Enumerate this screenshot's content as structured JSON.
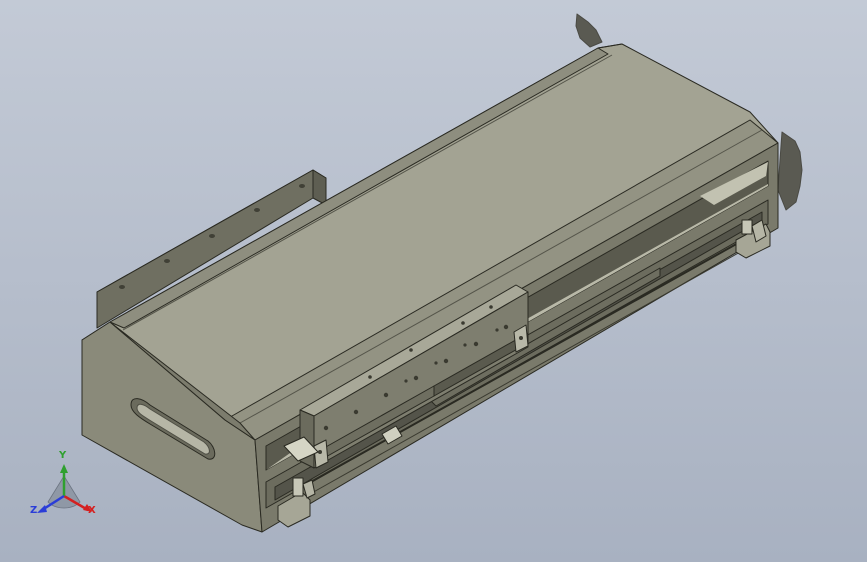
{
  "viewport": {
    "background_top": "#c3cad6",
    "background_bottom": "#a8b1c1"
  },
  "model": {
    "body_color": "#8a8a7a",
    "top_color": "#a2a292",
    "edge_color": "#2a2a22"
  },
  "triad": {
    "x_label": "X",
    "y_label": "Y",
    "z_label": "Z",
    "x_color": "#d42020",
    "y_color": "#2fa02f",
    "z_color": "#2a3dd8"
  }
}
